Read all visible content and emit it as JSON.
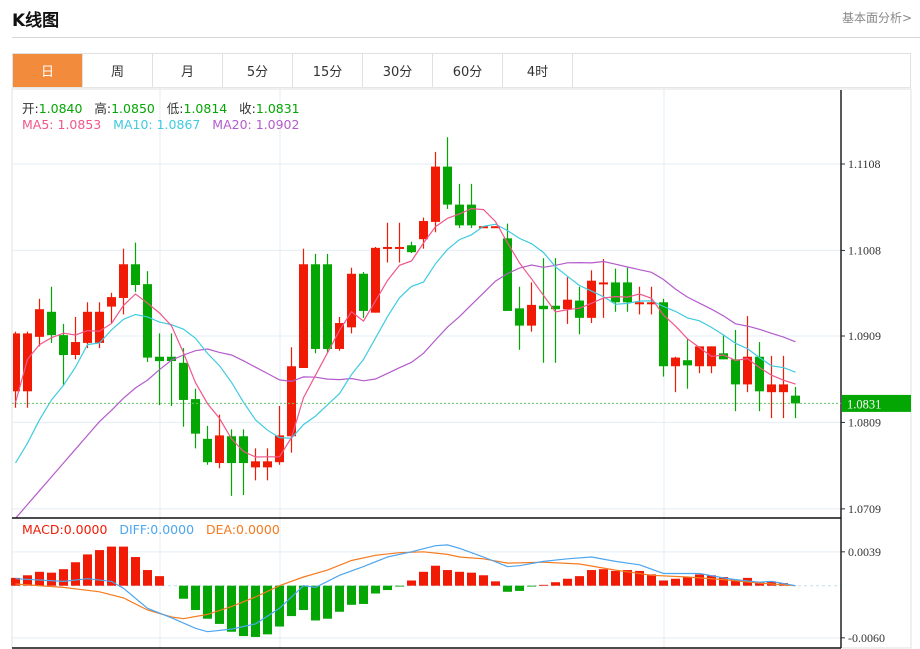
{
  "header": {
    "title": "K线图",
    "fundamental_link": "基本面分析>"
  },
  "tabs": [
    {
      "label": "日",
      "active": true
    },
    {
      "label": "周",
      "active": false
    },
    {
      "label": "月",
      "active": false
    },
    {
      "label": "5分",
      "active": false
    },
    {
      "label": "15分",
      "active": false
    },
    {
      "label": "30分",
      "active": false
    },
    {
      "label": "60分",
      "active": false
    },
    {
      "label": "4时",
      "active": false
    }
  ],
  "ohlc_legend": {
    "open_label": "开:",
    "open": "1.0840",
    "high_label": "高:",
    "high": "1.0850",
    "low_label": "低:",
    "low": "1.0814",
    "close_label": "收:",
    "close": "1.0831"
  },
  "ma_legend": {
    "ma5_label": "MA5:",
    "ma5": "1.0853",
    "ma10_label": "MA10:",
    "ma10": "1.0867",
    "ma20_label": "MA20:",
    "ma20": "1.0902"
  },
  "macd_legend": {
    "macd_label": "MACD:",
    "macd": "0.0000",
    "diff_label": "DIFF:",
    "diff": "0.0000",
    "dea_label": "DEA:",
    "dea": "0.0000"
  },
  "colors": {
    "up": "#f01a05",
    "down": "#04a604",
    "ma5": "#f0578a",
    "ma10": "#3fcbe0",
    "ma20": "#b45ccc",
    "diff": "#4da6f0",
    "dea": "#f57a1f",
    "accent": "#f28b3c",
    "last_price_bg": "#04a604"
  },
  "chart_data": [
    {
      "type": "candlestick",
      "y_ticks": [
        "1.1108",
        "1.1008",
        "1.0909",
        "1.0809",
        "1.0709"
      ],
      "ylim": [
        1.0709,
        1.1108
      ],
      "last_price": "1.0831",
      "ohlc": [
        [
          1.0845,
          1.0914,
          1.0826,
          1.0912
        ],
        [
          1.0845,
          1.0914,
          1.0826,
          1.0912
        ],
        [
          1.0908,
          1.0952,
          1.0897,
          1.094
        ],
        [
          1.0937,
          1.0966,
          1.0901,
          1.091
        ],
        [
          1.091,
          1.0923,
          1.0852,
          1.0887
        ],
        [
          1.0887,
          1.0931,
          1.0882,
          1.0902
        ],
        [
          1.0901,
          1.0948,
          1.0895,
          1.0937
        ],
        [
          1.0901,
          1.0948,
          1.0895,
          1.0937
        ],
        [
          1.0943,
          1.0959,
          1.0924,
          1.0954
        ],
        [
          1.0953,
          1.101,
          1.0934,
          1.0992
        ],
        [
          1.0992,
          1.1017,
          1.096,
          1.0968
        ],
        [
          1.0969,
          1.0984,
          1.0879,
          1.0884
        ],
        [
          1.0885,
          1.0912,
          1.0829,
          1.088
        ],
        [
          1.0885,
          1.0912,
          1.0828,
          1.088
        ],
        [
          1.0878,
          1.0895,
          1.0804,
          1.0835
        ],
        [
          1.0836,
          1.0848,
          1.0779,
          1.0796
        ],
        [
          1.079,
          1.0805,
          1.076,
          1.0763
        ],
        [
          1.0762,
          1.0818,
          1.0756,
          1.0794
        ],
        [
          1.0793,
          1.0801,
          1.0724,
          1.0762
        ],
        [
          1.0793,
          1.0801,
          1.0725,
          1.0762
        ],
        [
          1.0757,
          1.0779,
          1.0742,
          1.0764
        ],
        [
          1.0757,
          1.0779,
          1.0742,
          1.0764
        ],
        [
          1.0763,
          1.0828,
          1.076,
          1.0794
        ],
        [
          1.0793,
          1.0896,
          1.0774,
          1.0874
        ],
        [
          1.0872,
          1.101,
          1.0872,
          1.0992
        ],
        [
          1.0992,
          1.1004,
          1.0889,
          1.0894
        ],
        [
          1.0992,
          1.1004,
          1.0889,
          1.0894
        ],
        [
          1.0894,
          1.0931,
          1.0892,
          1.0924
        ],
        [
          1.0919,
          1.0988,
          1.0912,
          1.0981
        ],
        [
          1.0981,
          1.0983,
          1.093,
          1.0938
        ],
        [
          1.0936,
          1.1012,
          1.0936,
          1.1011
        ],
        [
          1.101,
          1.104,
          1.0994,
          1.1012
        ],
        [
          1.101,
          1.104,
          1.0994,
          1.1012
        ],
        [
          1.1014,
          1.1018,
          1.1005,
          1.1006
        ],
        [
          1.1021,
          1.1046,
          1.101,
          1.1042
        ],
        [
          1.1041,
          1.1122,
          1.1029,
          1.1105
        ],
        [
          1.1105,
          1.1139,
          1.1056,
          1.1061
        ],
        [
          1.1061,
          1.1085,
          1.1034,
          1.1037
        ],
        [
          1.1061,
          1.1085,
          1.1034,
          1.1037
        ],
        [
          1.1035,
          1.1036,
          1.1035,
          1.1036
        ],
        [
          1.1035,
          1.1036,
          1.1035,
          1.1036
        ],
        [
          1.1022,
          1.1039,
          1.0938,
          1.0938
        ],
        [
          1.0941,
          1.0966,
          1.0893,
          1.0921
        ],
        [
          1.0921,
          1.0971,
          1.0914,
          1.0945
        ],
        [
          1.0944,
          1.0999,
          1.0878,
          1.094
        ],
        [
          1.0944,
          1.0999,
          1.0878,
          1.094
        ],
        [
          1.094,
          1.0977,
          1.0923,
          1.0951
        ],
        [
          1.095,
          1.0966,
          1.0911,
          1.093
        ],
        [
          1.093,
          1.0985,
          1.0924,
          1.0973
        ],
        [
          1.097,
          1.0998,
          1.093,
          1.0971
        ],
        [
          1.0971,
          1.0987,
          1.0937,
          1.0948
        ],
        [
          1.0971,
          1.0988,
          1.0937,
          1.0948
        ],
        [
          1.0946,
          1.0966,
          1.0934,
          1.0948
        ],
        [
          1.0946,
          1.0966,
          1.0934,
          1.0948
        ],
        [
          1.0948,
          1.0952,
          1.0862,
          1.0874
        ],
        [
          1.0874,
          1.0885,
          1.0844,
          1.0884
        ],
        [
          1.0881,
          1.0905,
          1.0848,
          1.0875
        ],
        [
          1.0874,
          1.0897,
          1.0866,
          1.0897
        ],
        [
          1.0874,
          1.0897,
          1.0866,
          1.0897
        ],
        [
          1.0889,
          1.091,
          1.0882,
          1.0882
        ],
        [
          1.0882,
          1.0916,
          1.0822,
          1.0853
        ],
        [
          1.0853,
          1.0932,
          1.0844,
          1.0885
        ],
        [
          1.0885,
          1.0902,
          1.0822,
          1.0845
        ],
        [
          1.0844,
          1.0886,
          1.0814,
          1.0853
        ],
        [
          1.0844,
          1.0886,
          1.0814,
          1.0853
        ],
        [
          1.084,
          1.085,
          1.0814,
          1.0831
        ]
      ],
      "ma_seed": {
        "ma5": [
          1.0832,
          1.0882,
          1.0899,
          1.0907
        ],
        "ma10": [
          1.0762,
          1.0785,
          1.0812,
          1.0835,
          1.0852,
          1.0873,
          1.0899,
          1.0901,
          1.0916
        ],
        "ma20": [
          1.0698,
          1.0714,
          1.073,
          1.0746,
          1.0762,
          1.0778,
          1.0794,
          1.081,
          1.0823,
          1.0837,
          1.0849,
          1.0858,
          1.087,
          1.0881,
          1.0887,
          1.0892,
          1.0894,
          1.089,
          1.0887
        ]
      }
    },
    {
      "type": "macd",
      "y_ticks": [
        "0.0039",
        "-0.0060"
      ],
      "ylim": [
        -0.006,
        0.0039
      ],
      "histogram": [
        0.0009,
        0.0012,
        0.0016,
        0.0015,
        0.0019,
        0.0027,
        0.0036,
        0.0041,
        0.0045,
        0.0045,
        0.0033,
        0.0018,
        0.0011,
        0.0,
        -0.0015,
        -0.0028,
        -0.0038,
        -0.0044,
        -0.0053,
        -0.0058,
        -0.0059,
        -0.0056,
        -0.0047,
        -0.0035,
        -0.0028,
        -0.004,
        -0.0038,
        -0.003,
        -0.0022,
        -0.0021,
        -0.0009,
        -0.0005,
        -0.0001,
        0.0006,
        0.0016,
        0.0023,
        0.0018,
        0.0016,
        0.0015,
        0.0012,
        0.0005,
        -0.0007,
        -0.0006,
        -0.0001,
        0.0001,
        0.0004,
        0.0008,
        0.0011,
        0.0018,
        0.0019,
        0.0017,
        0.0018,
        0.0017,
        0.0013,
        0.0006,
        0.0008,
        0.001,
        0.0013,
        0.0012,
        0.001,
        0.0007,
        0.0009,
        0.0004,
        0.0005,
        0.0003,
        0.0
      ],
      "diff": [
        [
          0,
          0.0008
        ],
        [
          4,
          0.0005
        ],
        [
          6,
          0.0008
        ],
        [
          8,
          0.0005
        ],
        [
          9,
          -0.0003
        ],
        [
          11,
          -0.0026
        ],
        [
          13,
          -0.0037
        ],
        [
          15,
          -0.0049
        ],
        [
          16,
          -0.0053
        ],
        [
          18,
          -0.005
        ],
        [
          20,
          -0.0044
        ],
        [
          22,
          -0.0026
        ],
        [
          24,
          0.0
        ],
        [
          25,
          -0.0002
        ],
        [
          27,
          0.0012
        ],
        [
          29,
          0.0022
        ],
        [
          31,
          0.0033
        ],
        [
          33,
          0.0039
        ],
        [
          35,
          0.0046
        ],
        [
          36,
          0.0047
        ],
        [
          37,
          0.0043
        ],
        [
          39,
          0.0033
        ],
        [
          41,
          0.0022
        ],
        [
          42,
          0.0023
        ],
        [
          44,
          0.0028
        ],
        [
          46,
          0.0031
        ],
        [
          48,
          0.0033
        ],
        [
          50,
          0.0028
        ],
        [
          52,
          0.0024
        ],
        [
          54,
          0.0014
        ],
        [
          57,
          0.0014
        ],
        [
          59,
          0.0009
        ],
        [
          60,
          0.0007
        ],
        [
          62,
          0.0004
        ],
        [
          63,
          0.0005
        ],
        [
          65,
          0.0
        ]
      ],
      "dea": [
        [
          0,
          0.0002
        ],
        [
          4,
          -0.0002
        ],
        [
          7,
          -0.0007
        ],
        [
          9,
          -0.0014
        ],
        [
          11,
          -0.0028
        ],
        [
          13,
          -0.0036
        ],
        [
          14,
          -0.0038
        ],
        [
          16,
          -0.0033
        ],
        [
          18,
          -0.0024
        ],
        [
          20,
          -0.0013
        ],
        [
          22,
          0.0
        ],
        [
          24,
          0.001
        ],
        [
          26,
          0.0018
        ],
        [
          28,
          0.0029
        ],
        [
          30,
          0.0035
        ],
        [
          32,
          0.0038
        ],
        [
          34,
          0.0039
        ],
        [
          36,
          0.0036
        ],
        [
          37,
          0.0033
        ],
        [
          39,
          0.0031
        ],
        [
          41,
          0.0026
        ],
        [
          44,
          0.0027
        ],
        [
          47,
          0.0025
        ],
        [
          50,
          0.0018
        ],
        [
          53,
          0.0012
        ],
        [
          56,
          0.001
        ],
        [
          59,
          0.0007
        ],
        [
          62,
          0.0003
        ],
        [
          65,
          0.0
        ]
      ]
    }
  ]
}
